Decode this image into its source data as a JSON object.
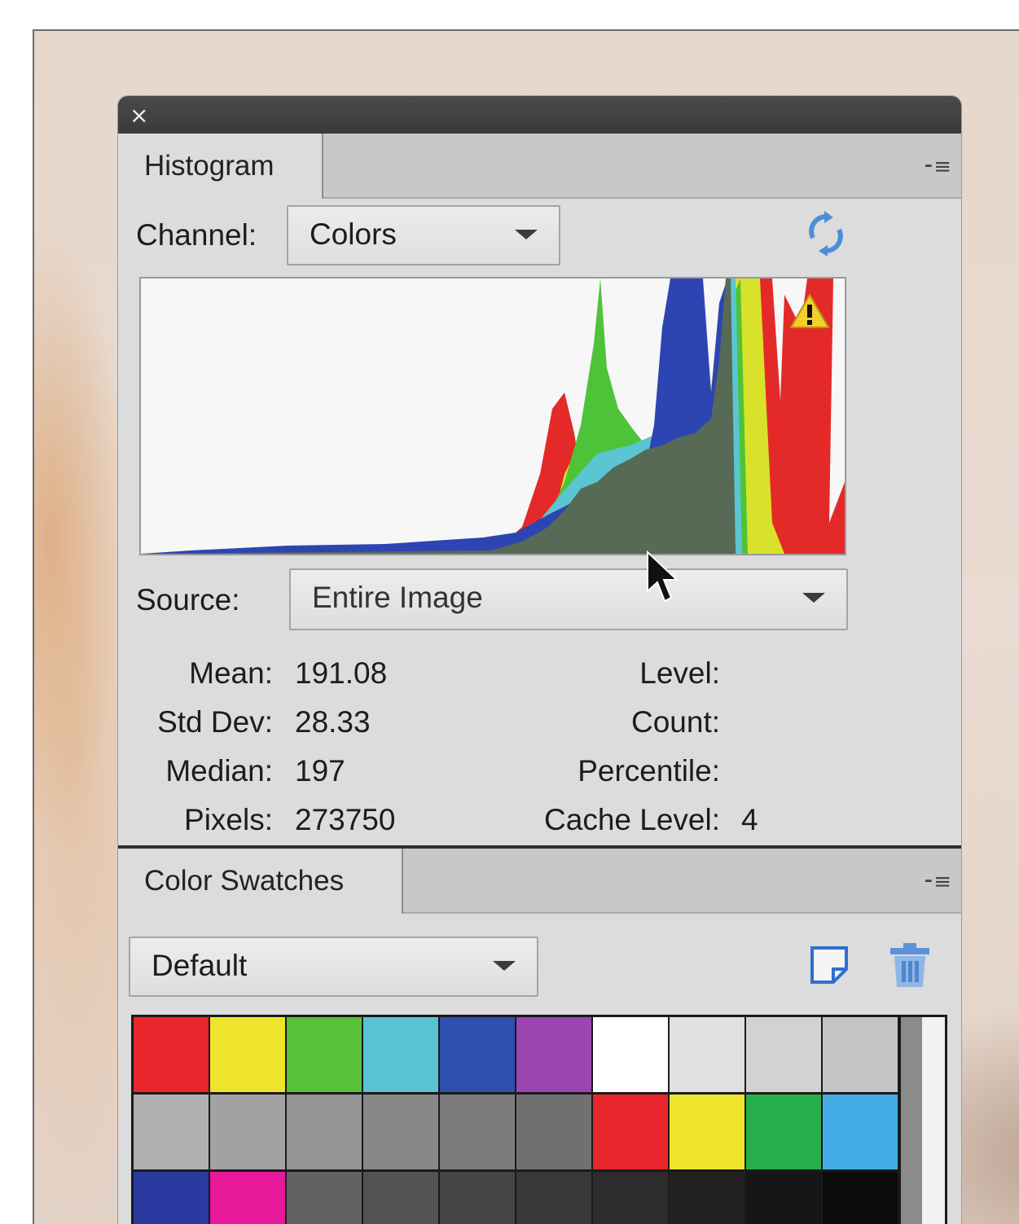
{
  "histogram_panel": {
    "tab_label": "Histogram",
    "channel_label": "Channel:",
    "channel_value": "Colors",
    "source_label": "Source:",
    "source_value": "Entire Image",
    "icons": {
      "close": "close-icon",
      "refresh": "refresh-icon",
      "warning": "warning-icon",
      "menu": "panel-menu-icon"
    },
    "stats": {
      "mean_label": "Mean:",
      "mean": "191.08",
      "std_label": "Std Dev:",
      "std": "28.33",
      "median_label": "Median:",
      "median": "197",
      "pixels_label": "Pixels:",
      "pixels": "273750",
      "level_label": "Level:",
      "level": "",
      "count_label": "Count:",
      "count": "",
      "percentile_label": "Percentile:",
      "percentile": "",
      "cache_label": "Cache Level:",
      "cache": "4"
    }
  },
  "swatches_panel": {
    "tab_label": "Color Swatches",
    "set_value": "Default",
    "icons": {
      "new": "new-swatch-icon",
      "delete": "trash-icon",
      "menu": "panel-menu-icon"
    },
    "rows": [
      [
        "#e8262b",
        "#efe42c",
        "#57c13a",
        "#5ac3d1",
        "#2f4fae",
        "#9c44b0",
        "#ffffff",
        "#e0e0e0",
        "#d2d2d2",
        "#c4c4c4"
      ],
      [
        "#b0b0b0",
        "#a2a2a2",
        "#959595",
        "#888888",
        "#7c7c7c",
        "#707070",
        "#e8262b",
        "#efe42c",
        "#27ae4d",
        "#42ade6"
      ],
      [
        "#2a3aa0",
        "#e8189a",
        "#626262",
        "#535353",
        "#454545",
        "#383838",
        "#2c2c2c",
        "#212121",
        "#161616",
        "#0c0c0c"
      ]
    ]
  },
  "colors": {
    "panel_bg": "#dcdcdc",
    "titlebar": "#3f3f3f",
    "refresh_blue": "#4a90d9",
    "histo_gray": "#566a56"
  }
}
